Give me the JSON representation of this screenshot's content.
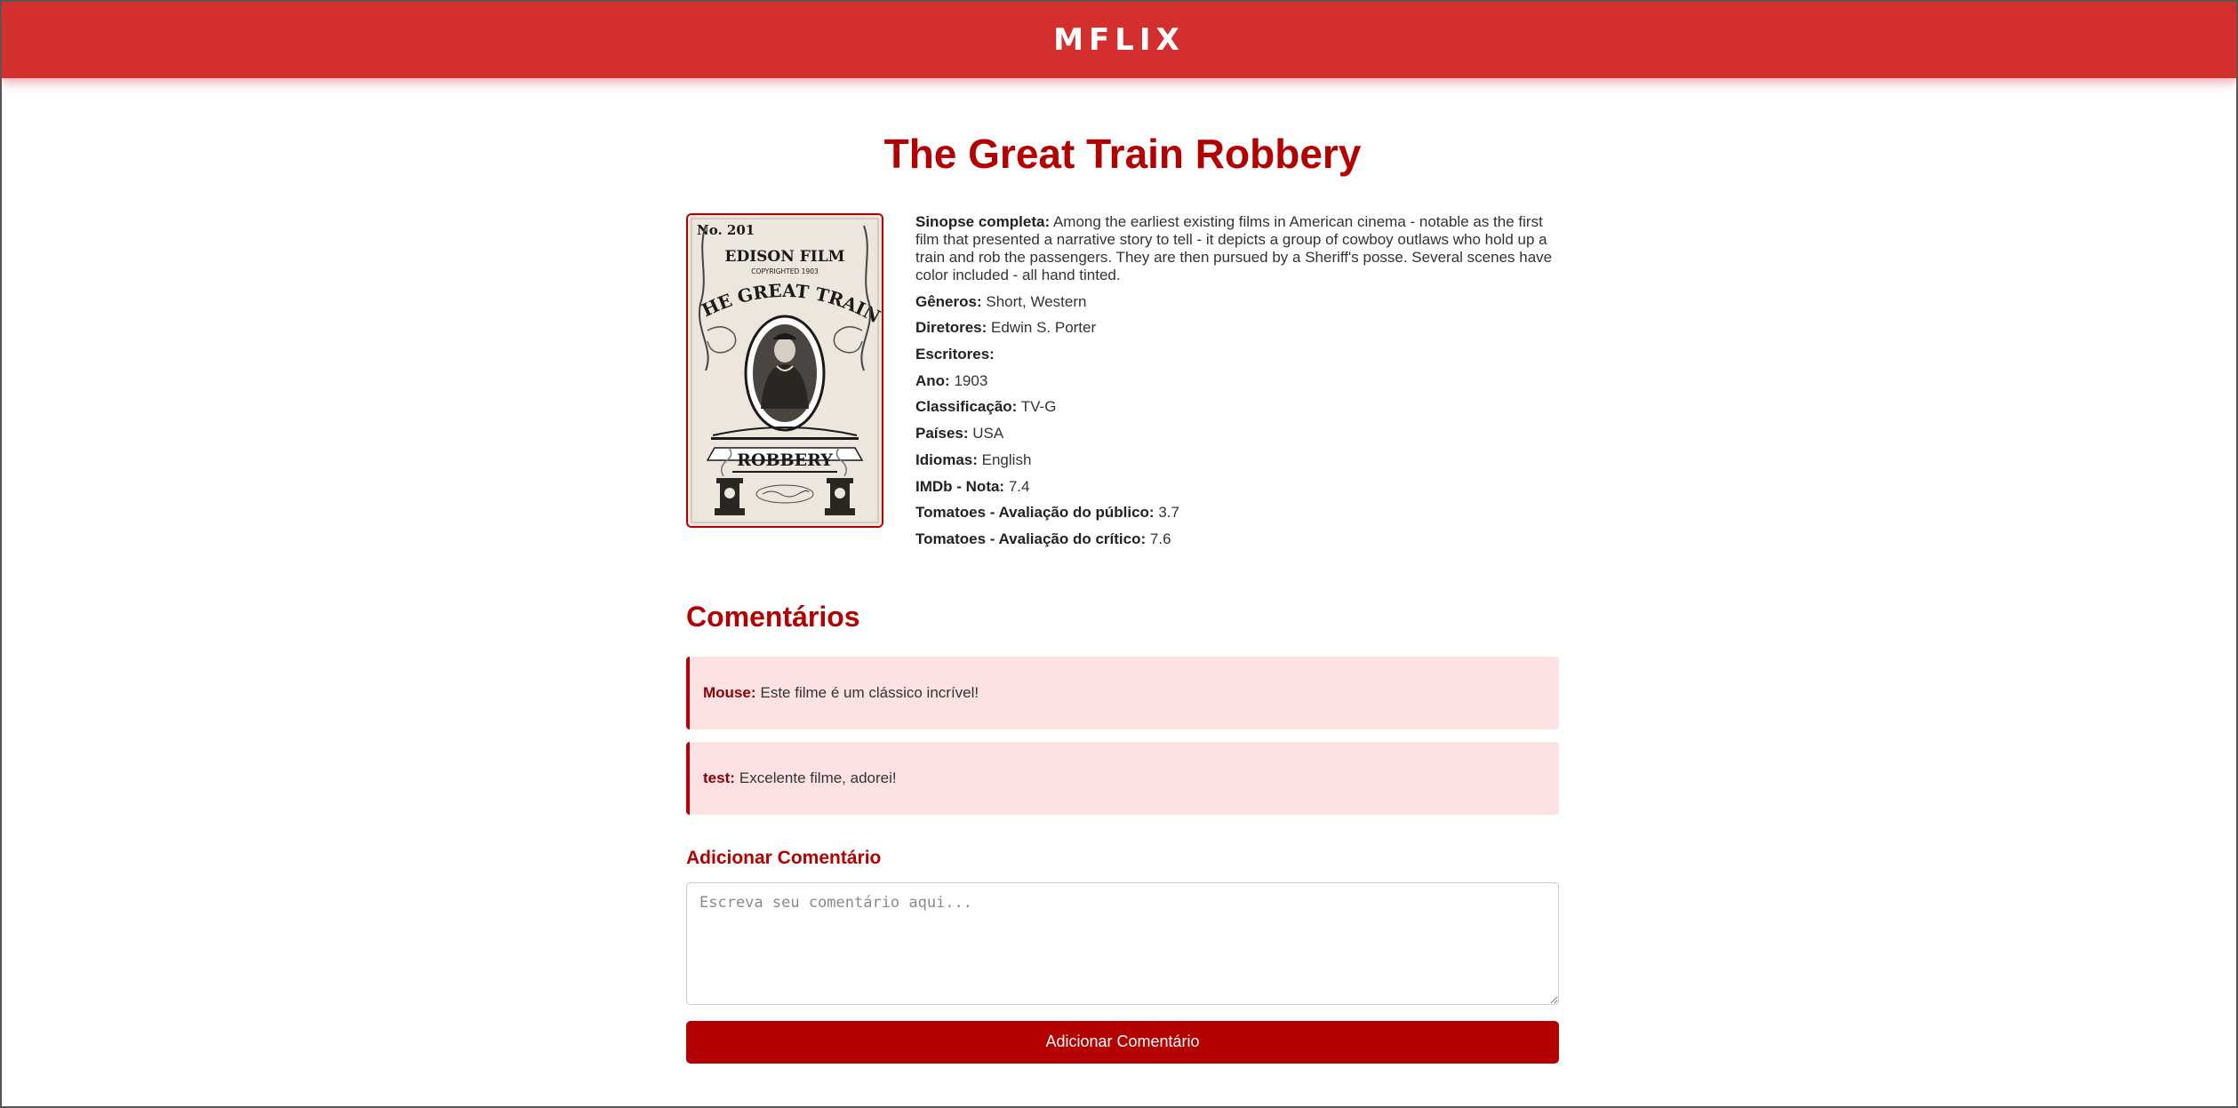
{
  "header": {
    "brand": "MFLIX"
  },
  "movie": {
    "title": "The Great Train Robbery",
    "poster": {
      "number": "No. 201",
      "company": "EDISON FILM",
      "copyright": "COPYRIGHTED 1903",
      "title_top": "THE GREAT TRAIN",
      "title_bottom": "ROBBERY"
    },
    "details": [
      {
        "label": "Sinopse completa:",
        "value": "Among the earliest existing films in American cinema - notable as the first film that presented a narrative story to tell - it depicts a group of cowboy outlaws who hold up a train and rob the passengers. They are then pursued by a Sheriff's posse. Several scenes have color included - all hand tinted."
      },
      {
        "label": "Gêneros:",
        "value": "Short, Western"
      },
      {
        "label": "Diretores:",
        "value": "Edwin S. Porter"
      },
      {
        "label": "Escritores:",
        "value": ""
      },
      {
        "label": "Ano:",
        "value": "1903"
      },
      {
        "label": "Classificação:",
        "value": "TV-G"
      },
      {
        "label": "Países:",
        "value": "USA"
      },
      {
        "label": "Idiomas:",
        "value": "English"
      },
      {
        "label": "IMDb - Nota:",
        "value": "7.4"
      },
      {
        "label": "Tomatoes - Avaliação do público:",
        "value": "3.7"
      },
      {
        "label": "Tomatoes - Avaliação do crítico:",
        "value": "7.6"
      }
    ]
  },
  "comments": {
    "title": "Comentários",
    "items": [
      {
        "author": "Mouse:",
        "text": "Este filme é um clássico incrível!"
      },
      {
        "author": "test:",
        "text": "Excelente filme, adorei!"
      }
    ]
  },
  "add_comment": {
    "title": "Adicionar Comentário",
    "placeholder": "Escreva seu comentário aqui...",
    "value": "",
    "button_label": "Adicionar Comentário"
  },
  "colors": {
    "header_bg": "#d32f2f",
    "accent": "#b30000",
    "comment_bg": "#fde2e4"
  }
}
